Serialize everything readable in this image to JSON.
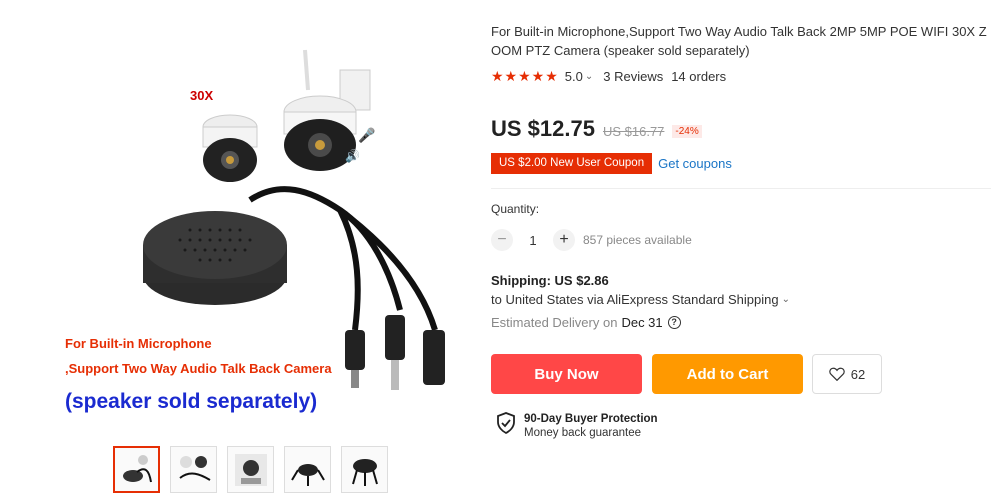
{
  "product": {
    "title": "For Built-in Microphone,Support Two Way Audio Talk Back 2MP 5MP POE WIFI 30X ZOOM PTZ Camera (speaker sold separately)",
    "image_text": {
      "badge": "30X",
      "line1": "For Built-in Microphone",
      "line2": ",Support Two Way Audio Talk Back Camera",
      "line3": "(speaker sold separately)"
    }
  },
  "rating": {
    "stars": "★★★★★",
    "score": "5.0",
    "reviews": "3 Reviews",
    "orders": "14 orders"
  },
  "price": {
    "current": "US $12.75",
    "original": "US $16.77",
    "discount": "-24%"
  },
  "coupon": {
    "label": "US $2.00 New User Coupon",
    "link": "Get coupons"
  },
  "quantity": {
    "label": "Quantity:",
    "minus": "−",
    "value": "1",
    "plus": "+",
    "available": "857 pieces available"
  },
  "shipping": {
    "title": "Shipping: US $2.86",
    "destination": "to United States via AliExpress Standard Shipping",
    "estimated_label": "Estimated Delivery on",
    "estimated_date": "Dec 31"
  },
  "actions": {
    "buy": "Buy Now",
    "cart": "Add to Cart",
    "wishlist_count": "62"
  },
  "protection": {
    "title": "90-Day Buyer Protection",
    "subtitle": "Money back guarantee"
  },
  "colors": {
    "accent": "#e62e04",
    "buy": "#ff4747",
    "cart": "#ff9900",
    "link": "#1a75c6"
  },
  "icons": [
    "star-icon",
    "caret-down-icon",
    "help-icon",
    "heart-icon",
    "shield-icon"
  ]
}
